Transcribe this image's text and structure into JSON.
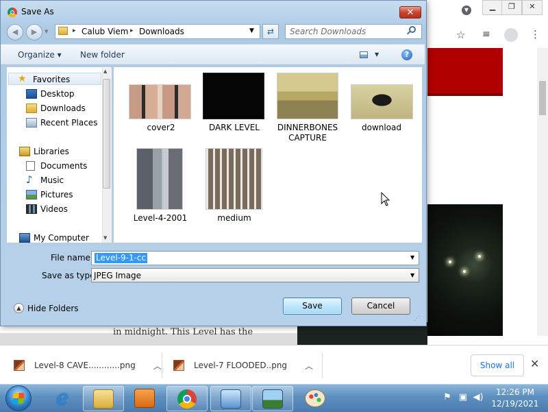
{
  "dialog": {
    "title": "Save As",
    "close_glyph": "✕",
    "address": {
      "crumbs": [
        "Calub Viem",
        "Downloads"
      ]
    },
    "search": {
      "placeholder": "Search Downloads"
    },
    "toolbar": {
      "organize": "Organize ▾",
      "new_folder": "New folder",
      "help": "?"
    },
    "nav_pane": {
      "groups": [
        {
          "label": "Favorites",
          "icon": "star-icon",
          "items": [
            {
              "label": "Desktop",
              "icon": "desktop-icon"
            },
            {
              "label": "Downloads",
              "icon": "downloads-folder-icon"
            },
            {
              "label": "Recent Places",
              "icon": "recent-places-icon"
            }
          ]
        },
        {
          "label": "Libraries",
          "icon": "libraries-icon",
          "items": [
            {
              "label": "Documents",
              "icon": "documents-icon"
            },
            {
              "label": "Music",
              "icon": "music-icon"
            },
            {
              "label": "Pictures",
              "icon": "pictures-icon"
            },
            {
              "label": "Videos",
              "icon": "videos-icon"
            }
          ]
        },
        {
          "label": "My Computer",
          "icon": "computer-icon",
          "items": []
        }
      ]
    },
    "files": [
      {
        "name": "cover2"
      },
      {
        "name": "DARK LEVEL"
      },
      {
        "name": "DINNERBONES CAPTURE"
      },
      {
        "name": "download"
      },
      {
        "name": "Level-4-2001"
      },
      {
        "name": "medium"
      }
    ],
    "form": {
      "file_name_label": "File name:",
      "file_name_value": "Level-9-1-cc",
      "save_type_label": "Save as type:",
      "save_type_value": "JPEG Image"
    },
    "hide_folders": "Hide Folders",
    "save_button": "Save",
    "cancel_button": "Cancel"
  },
  "background_page": {
    "text_fragment": "in midnight. This Level has the"
  },
  "download_shelf": {
    "items": [
      {
        "name": "Level-8 CAVE............png"
      },
      {
        "name": "Level-7 FLOODED..png"
      }
    ],
    "show_all": "Show all",
    "close_glyph": "✕"
  },
  "taskbar": {
    "apps": [
      "internet-explorer-icon",
      "file-explorer-icon",
      "media-player-icon",
      "chrome-icon",
      "control-panel-icon",
      "picture-viewer-icon",
      "paint-icon"
    ],
    "clock_time": "12:26 PM",
    "clock_date": "12/19/2021"
  }
}
